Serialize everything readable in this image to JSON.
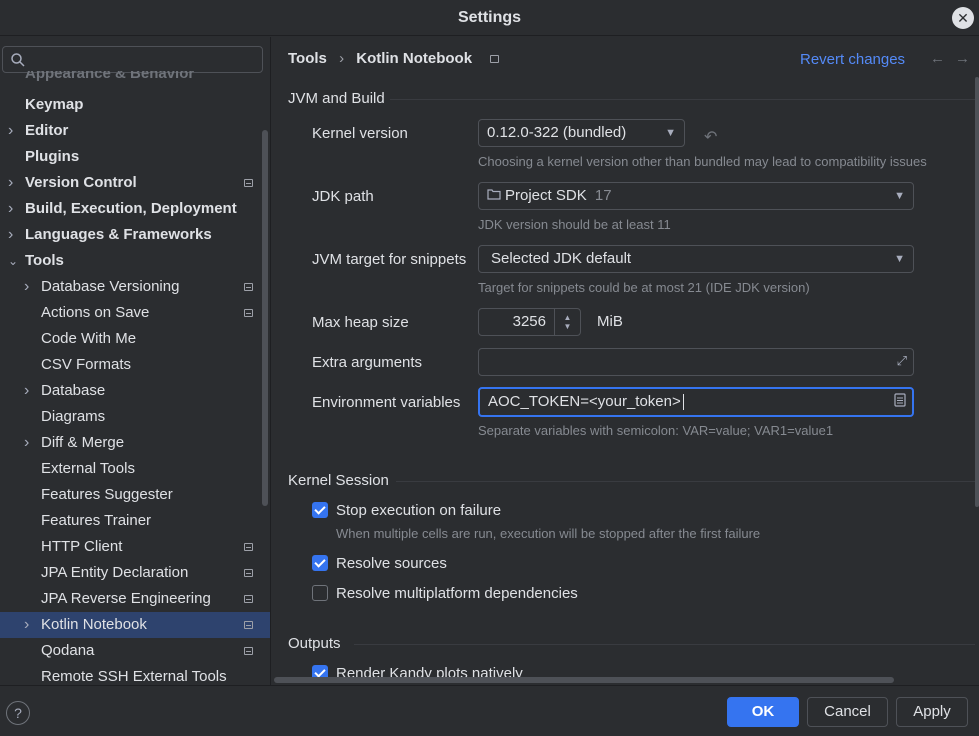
{
  "window": {
    "title": "Settings",
    "close_icon": "close-icon"
  },
  "sidebar": {
    "search_placeholder": "",
    "faded_item": "Appearance & Behavior",
    "items": [
      {
        "label": "Keymap",
        "level": 0,
        "bold": true,
        "chevron": false,
        "project": false
      },
      {
        "label": "Editor",
        "level": 0,
        "bold": true,
        "chevron": "right",
        "project": false
      },
      {
        "label": "Plugins",
        "level": 0,
        "bold": true,
        "chevron": false,
        "project": false
      },
      {
        "label": "Version Control",
        "level": 0,
        "bold": true,
        "chevron": "right",
        "project": true
      },
      {
        "label": "Build, Execution, Deployment",
        "level": 0,
        "bold": true,
        "chevron": "right",
        "project": false
      },
      {
        "label": "Languages & Frameworks",
        "level": 0,
        "bold": true,
        "chevron": "right",
        "project": false
      },
      {
        "label": "Tools",
        "level": 0,
        "bold": true,
        "chevron": "down",
        "project": false
      },
      {
        "label": "Database Versioning",
        "level": 1,
        "bold": false,
        "chevron": "right",
        "project": true
      },
      {
        "label": "Actions on Save",
        "level": 1,
        "bold": false,
        "chevron": false,
        "project": true
      },
      {
        "label": "Code With Me",
        "level": 1,
        "bold": false,
        "chevron": false,
        "project": false
      },
      {
        "label": "CSV Formats",
        "level": 1,
        "bold": false,
        "chevron": false,
        "project": false
      },
      {
        "label": "Database",
        "level": 1,
        "bold": false,
        "chevron": "right",
        "project": false
      },
      {
        "label": "Diagrams",
        "level": 1,
        "bold": false,
        "chevron": false,
        "project": false
      },
      {
        "label": "Diff & Merge",
        "level": 1,
        "bold": false,
        "chevron": "right",
        "project": false
      },
      {
        "label": "External Tools",
        "level": 1,
        "bold": false,
        "chevron": false,
        "project": false
      },
      {
        "label": "Features Suggester",
        "level": 1,
        "bold": false,
        "chevron": false,
        "project": false
      },
      {
        "label": "Features Trainer",
        "level": 1,
        "bold": false,
        "chevron": false,
        "project": false
      },
      {
        "label": "HTTP Client",
        "level": 1,
        "bold": false,
        "chevron": false,
        "project": true
      },
      {
        "label": "JPA Entity Declaration",
        "level": 1,
        "bold": false,
        "chevron": false,
        "project": true
      },
      {
        "label": "JPA Reverse Engineering",
        "level": 1,
        "bold": false,
        "chevron": false,
        "project": true
      },
      {
        "label": "Kotlin Notebook",
        "level": 1,
        "bold": false,
        "chevron": "right",
        "project": true,
        "selected": true
      },
      {
        "label": "Qodana",
        "level": 1,
        "bold": false,
        "chevron": false,
        "project": true
      },
      {
        "label": "Remote SSH External Tools",
        "level": 1,
        "bold": false,
        "chevron": false,
        "project": false
      }
    ]
  },
  "header": {
    "crumb_parent": "Tools",
    "crumb_sep": "›",
    "crumb_current": "Kotlin Notebook",
    "revert": "Revert changes",
    "back": "←",
    "forward": "→"
  },
  "jvm": {
    "section": "JVM and Build",
    "kernel_label": "Kernel version",
    "kernel_value": "0.12.0-322 (bundled)",
    "kernel_hint": "Choosing a kernel version other than bundled may lead to compatibility issues",
    "jdk_label": "JDK path",
    "jdk_value": "Project SDK",
    "jdk_version": "17",
    "jdk_hint": "JDK version should be at least 11",
    "target_label": "JVM target for snippets",
    "target_value": "Selected JDK default",
    "target_hint": "Target for snippets could be at most 21 (IDE JDK version)",
    "heap_label": "Max heap size",
    "heap_value": "3256",
    "heap_unit": "MiB",
    "extra_label": "Extra arguments",
    "extra_value": "",
    "env_label": "Environment variables",
    "env_value": "AOC_TOKEN=<your_token>",
    "env_hint": "Separate variables with semicolon: VAR=value; VAR1=value1"
  },
  "kernel_session": {
    "section": "Kernel Session",
    "stop_label": "Stop execution on failure",
    "stop_checked": true,
    "stop_hint": "When multiple cells are run, execution will be stopped after the first failure",
    "resolve_label": "Resolve sources",
    "resolve_checked": true,
    "multiplatform_label": "Resolve multiplatform dependencies",
    "multiplatform_checked": false
  },
  "outputs": {
    "section": "Outputs",
    "kandy_label": "Render Kandy plots natively",
    "kandy_checked": true
  },
  "footer": {
    "help": "?",
    "ok": "OK",
    "cancel": "Cancel",
    "apply": "Apply"
  },
  "colors": {
    "accent": "#3574f0",
    "selection": "#2e436e",
    "link": "#548af7",
    "background": "#2b2d30"
  }
}
